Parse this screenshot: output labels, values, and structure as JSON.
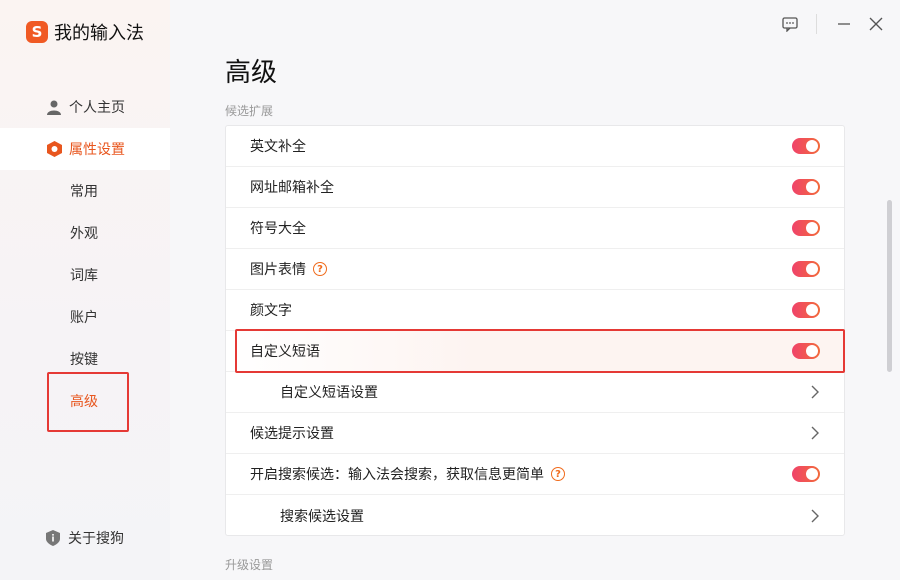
{
  "app": {
    "title": "我的输入法",
    "logo_char": "S"
  },
  "window_controls": {
    "feedback_icon": "chat-icon",
    "minimize_icon": "minimize-icon",
    "close_icon": "close-icon"
  },
  "sidebar": {
    "items": [
      {
        "label": "个人主页",
        "icon": "user-icon"
      },
      {
        "label": "属性设置",
        "icon": "hexagon-icon",
        "active": true
      },
      {
        "label": "常用"
      },
      {
        "label": "外观"
      },
      {
        "label": "词库"
      },
      {
        "label": "账户"
      },
      {
        "label": "按键"
      },
      {
        "label": "高级",
        "active": true
      }
    ],
    "about": {
      "label": "关于搜狗",
      "icon": "info-shield-icon"
    }
  },
  "main": {
    "title": "高级",
    "section1": "候选扩展",
    "section2": "升级设置",
    "rows": [
      {
        "label": "英文补全",
        "control": "toggle",
        "on": true
      },
      {
        "label": "网址邮箱补全",
        "control": "toggle",
        "on": true
      },
      {
        "label": "符号大全",
        "control": "toggle",
        "on": true
      },
      {
        "label": "图片表情",
        "control": "toggle",
        "on": true,
        "help": "?"
      },
      {
        "label": "颜文字",
        "control": "toggle",
        "on": true
      },
      {
        "label": "自定义短语",
        "control": "toggle",
        "on": true
      },
      {
        "label": "自定义短语设置",
        "control": "chevron"
      },
      {
        "label": "候选提示设置",
        "control": "chevron"
      },
      {
        "label": "开启搜索候选：输入法会搜索，获取信息更简单",
        "control": "toggle",
        "on": true,
        "help": "?"
      },
      {
        "label": "搜索候选设置",
        "control": "chevron"
      }
    ]
  },
  "colors": {
    "accent": "#e8561e",
    "toggle_start": "#f0436a",
    "toggle_end": "#f26a3b",
    "highlight": "#e53935"
  }
}
